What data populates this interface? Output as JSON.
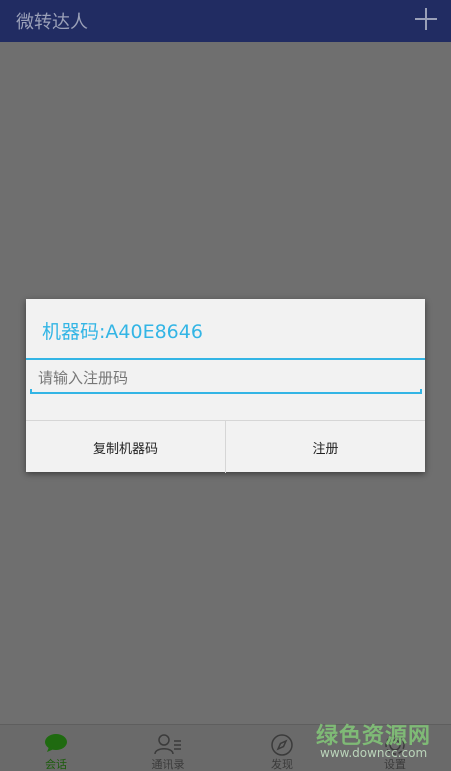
{
  "appbar": {
    "title": "微转达人",
    "add_icon": "plus-icon"
  },
  "dialog": {
    "title": "机器码:A40E8646",
    "input": {
      "value": "",
      "placeholder": "请输入注册码"
    },
    "buttons": {
      "copy_label": "复制机器码",
      "register_label": "注册"
    },
    "accent_color": "#33b5e5"
  },
  "bottom_nav": {
    "items": [
      {
        "label": "会话",
        "icon": "chat-bubble-icon",
        "active": true
      },
      {
        "label": "通讯录",
        "icon": "contacts-icon",
        "active": false
      },
      {
        "label": "发现",
        "icon": "compass-icon",
        "active": false
      },
      {
        "label": "设置",
        "icon": "settings-icon",
        "active": false
      }
    ]
  },
  "watermark": {
    "text": "绿色资源网",
    "url": "www.downcc.com"
  }
}
